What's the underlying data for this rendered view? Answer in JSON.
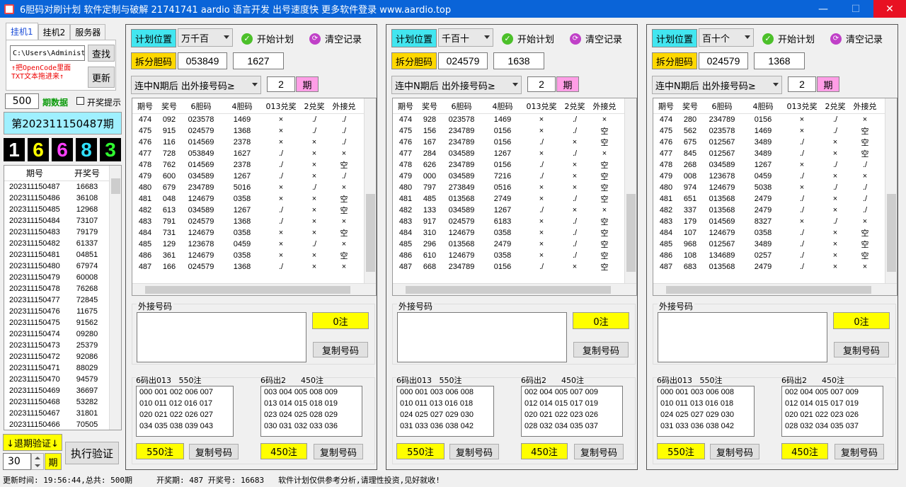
{
  "window": {
    "title": "6胆码对刷计划 软件定制与破解 21741741 aardio 语言开发 出号速度快 更多软件登录 www.aardio.top",
    "min": "—",
    "max": "☐",
    "close": "✕"
  },
  "sidebar": {
    "tabs": [
      "挂机1",
      "挂机2",
      "服务器"
    ],
    "path_value": "C:\\Users\\Administ",
    "find_label": "查找",
    "update_label": "更新",
    "hint_line1": "↑把OpenCode里面",
    "hint_line2": "TXT文本拖进来↑",
    "period_count": "500",
    "period_data_label": "期数据",
    "notify_label": "开奖提示",
    "current_issue": "第202311150487期",
    "digits": [
      "1",
      "6",
      "6",
      "8",
      "3"
    ],
    "digit_colors": [
      "#ffffff",
      "#ffff00",
      "#ff40ff",
      "#30e0ff",
      "#30ff30"
    ],
    "history_headers": [
      "期号",
      "开奖号"
    ],
    "history": [
      [
        "202311150487",
        "16683"
      ],
      [
        "202311150486",
        "36108"
      ],
      [
        "202311150485",
        "12968"
      ],
      [
        "202311150484",
        "73107"
      ],
      [
        "202311150483",
        "79179"
      ],
      [
        "202311150482",
        "61337"
      ],
      [
        "202311150481",
        "04851"
      ],
      [
        "202311150480",
        "67974"
      ],
      [
        "202311150479",
        "60008"
      ],
      [
        "202311150478",
        "76268"
      ],
      [
        "202311150477",
        "72845"
      ],
      [
        "202311150476",
        "11675"
      ],
      [
        "202311150475",
        "91562"
      ],
      [
        "202311150474",
        "09280"
      ],
      [
        "202311150473",
        "25379"
      ],
      [
        "202311150472",
        "92086"
      ],
      [
        "202311150471",
        "88029"
      ],
      [
        "202311150470",
        "94579"
      ],
      [
        "202311150469",
        "36697"
      ],
      [
        "202311150468",
        "53282"
      ],
      [
        "202311150467",
        "31801"
      ],
      [
        "202311150466",
        "70505"
      ]
    ],
    "backtest_label": "↓退期验证↓",
    "backtest_value": "30",
    "period_unit": "期",
    "execute_label": "执行验证"
  },
  "panels": [
    {
      "plan_pos_label": "计划位置",
      "plan_pos_value": "万千百",
      "start_label": "开始计划",
      "clear_label": "清空记录",
      "split_label": "拆分胆码",
      "split_value": "053849",
      "split_count": "1627",
      "condition_value": "连中N期后 出外接号码≥",
      "n_value": "2",
      "n_unit": "期",
      "headers": [
        "期号",
        "奖号",
        "6胆码",
        "4胆码",
        "013兑奖",
        "2兑奖",
        "外接兑"
      ],
      "rows": [
        [
          "474",
          "092",
          "023578",
          "1469",
          "×",
          "./",
          "./"
        ],
        [
          "475",
          "915",
          "024579",
          "1368",
          "×",
          "./",
          "./"
        ],
        [
          "476",
          "116",
          "014569",
          "2378",
          "×",
          "×",
          "./"
        ],
        [
          "477",
          "728",
          "053849",
          "1627",
          "./",
          "×",
          "×"
        ],
        [
          "478",
          "762",
          "014569",
          "2378",
          "./",
          "×",
          "空"
        ],
        [
          "479",
          "600",
          "034589",
          "1267",
          "./",
          "×",
          "./"
        ],
        [
          "480",
          "679",
          "234789",
          "5016",
          "×",
          "./",
          "×"
        ],
        [
          "481",
          "048",
          "124679",
          "0358",
          "×",
          "×",
          "空"
        ],
        [
          "482",
          "613",
          "034589",
          "1267",
          "./",
          "×",
          "空"
        ],
        [
          "483",
          "791",
          "024579",
          "1368",
          "./",
          "×",
          "×"
        ],
        [
          "484",
          "731",
          "124679",
          "0358",
          "×",
          "×",
          "空"
        ],
        [
          "485",
          "129",
          "123678",
          "0459",
          "×",
          "./",
          "×"
        ],
        [
          "486",
          "361",
          "124679",
          "0358",
          "×",
          "×",
          "空"
        ],
        [
          "487",
          "166",
          "024579",
          "1368",
          "./",
          "×",
          "×"
        ]
      ],
      "ext_label": "外接号码",
      "ext_count": "0注",
      "copy_label": "复制号码",
      "g1_label": "6码出013",
      "g1_count": "550注",
      "g1_lines": [
        "000 001 002 006 007",
        "010 011 012 016 017",
        "020 021 022 026 027",
        "034 035 038 039 043"
      ],
      "g2_label": "6码出2",
      "g2_count": "450注",
      "g2_lines": [
        "003 004 005 008 009",
        "013 014 015 018 019",
        "023 024 025 028 029",
        "030 031 032 033 036"
      ]
    },
    {
      "plan_pos_label": "计划位置",
      "plan_pos_value": "千百十",
      "start_label": "开始计划",
      "clear_label": "清空记录",
      "split_label": "拆分胆码",
      "split_value": "024579",
      "split_count": "1638",
      "condition_value": "连中N期后 出外接号码≥",
      "n_value": "2",
      "n_unit": "期",
      "headers": [
        "期号",
        "奖号",
        "6胆码",
        "4胆码",
        "013兑奖",
        "2兑奖",
        "外接兑"
      ],
      "rows": [
        [
          "474",
          "928",
          "023578",
          "1469",
          "×",
          "./",
          "×"
        ],
        [
          "475",
          "156",
          "234789",
          "0156",
          "×",
          "./",
          "空"
        ],
        [
          "476",
          "167",
          "234789",
          "0156",
          "./",
          "×",
          "空"
        ],
        [
          "477",
          "284",
          "034589",
          "1267",
          "×",
          "./",
          "×"
        ],
        [
          "478",
          "626",
          "234789",
          "0156",
          "./",
          "×",
          "空"
        ],
        [
          "479",
          "000",
          "034589",
          "7216",
          "./",
          "×",
          "空"
        ],
        [
          "480",
          "797",
          "273849",
          "0516",
          "×",
          "×",
          "空"
        ],
        [
          "481",
          "485",
          "013568",
          "2749",
          "×",
          "./",
          "空"
        ],
        [
          "482",
          "133",
          "034589",
          "1267",
          "./",
          "×",
          "×"
        ],
        [
          "483",
          "917",
          "024579",
          "6183",
          "×",
          "./",
          "空"
        ],
        [
          "484",
          "310",
          "124679",
          "0358",
          "×",
          "./",
          "空"
        ],
        [
          "485",
          "296",
          "013568",
          "2479",
          "×",
          "./",
          "空"
        ],
        [
          "486",
          "610",
          "124679",
          "0358",
          "×",
          "./",
          "空"
        ],
        [
          "487",
          "668",
          "234789",
          "0156",
          "./",
          "×",
          "空"
        ]
      ],
      "ext_label": "外接号码",
      "ext_count": "0注",
      "copy_label": "复制号码",
      "g1_label": "6码出013",
      "g1_count": "550注",
      "g1_lines": [
        "000 001 003 006 008",
        "010 011 013 016 018",
        "024 025 027 029 030",
        "031 033 036 038 042"
      ],
      "g2_label": "6码出2",
      "g2_count": "450注",
      "g2_lines": [
        "002 004 005 007 009",
        "012 014 015 017 019",
        "020 021 022 023 026",
        "028 032 034 035 037"
      ]
    },
    {
      "plan_pos_label": "计划位置",
      "plan_pos_value": "百十个",
      "start_label": "开始计划",
      "clear_label": "清空记录",
      "split_label": "拆分胆码",
      "split_value": "024579",
      "split_count": "1368",
      "condition_value": "连中N期后 出外接号码≥",
      "n_value": "2",
      "n_unit": "期",
      "headers": [
        "期号",
        "奖号",
        "6胆码",
        "4胆码",
        "013兑奖",
        "2兑奖",
        "外接兑"
      ],
      "rows": [
        [
          "474",
          "280",
          "234789",
          "0156",
          "×",
          "./",
          "×"
        ],
        [
          "475",
          "562",
          "023578",
          "1469",
          "×",
          "./",
          "空"
        ],
        [
          "476",
          "675",
          "012567",
          "3489",
          "./",
          "×",
          "空"
        ],
        [
          "477",
          "845",
          "012567",
          "3489",
          "./",
          "×",
          "空"
        ],
        [
          "478",
          "268",
          "034589",
          "1267",
          "×",
          "./",
          "./"
        ],
        [
          "479",
          "008",
          "123678",
          "0459",
          "./",
          "×",
          "×"
        ],
        [
          "480",
          "974",
          "124679",
          "5038",
          "×",
          "./",
          "./"
        ],
        [
          "481",
          "651",
          "013568",
          "2479",
          "./",
          "×",
          "./"
        ],
        [
          "482",
          "337",
          "013568",
          "2479",
          "./",
          "×",
          "./"
        ],
        [
          "483",
          "179",
          "014569",
          "8327",
          "×",
          "./",
          "×"
        ],
        [
          "484",
          "107",
          "124679",
          "0358",
          "./",
          "×",
          "空"
        ],
        [
          "485",
          "968",
          "012567",
          "3489",
          "./",
          "×",
          "空"
        ],
        [
          "486",
          "108",
          "134689",
          "0257",
          "./",
          "×",
          "空"
        ],
        [
          "487",
          "683",
          "013568",
          "2479",
          "./",
          "×",
          "×"
        ]
      ],
      "ext_label": "外接号码",
      "ext_count": "0注",
      "copy_label": "复制号码",
      "g1_label": "6码出013",
      "g1_count": "550注",
      "g1_lines": [
        "000 001 003 006 008",
        "010 011 013 016 018",
        "024 025 027 029 030",
        "031 033 036 038 042"
      ],
      "g2_label": "6码出2",
      "g2_count": "450注",
      "g2_lines": [
        "002 004 005 007 009",
        "012 014 015 017 019",
        "020 021 022 023 026",
        "028 032 034 035 037"
      ]
    }
  ],
  "status": {
    "update_time": "更新时间: 19:56:44,总共: 500期",
    "draw_info": "开奖期: 487 开奖号: 16683",
    "disclaimer": "软件计划仅供参考分析,请理性投资,见好就收!"
  }
}
